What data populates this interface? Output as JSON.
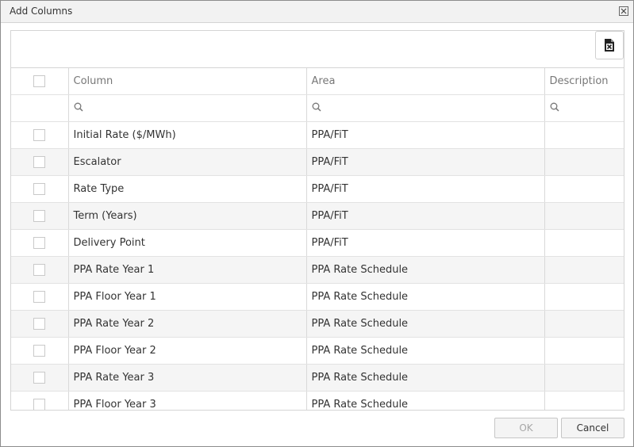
{
  "dialog": {
    "title": "Add Columns",
    "ok_label": "OK",
    "cancel_label": "Cancel",
    "ok_enabled": false
  },
  "toolbar": {
    "export_icon": "excel-export-icon"
  },
  "grid": {
    "headers": {
      "column": "Column",
      "area": "Area",
      "description": "Description"
    },
    "rows": [
      {
        "column": "Initial Rate ($/MWh)",
        "area": "PPA/FiT",
        "description": "",
        "checked": false
      },
      {
        "column": "Escalator",
        "area": "PPA/FiT",
        "description": "",
        "checked": false
      },
      {
        "column": "Rate Type",
        "area": "PPA/FiT",
        "description": "",
        "checked": false
      },
      {
        "column": "Term (Years)",
        "area": "PPA/FiT",
        "description": "",
        "checked": false
      },
      {
        "column": "Delivery Point",
        "area": "PPA/FiT",
        "description": "",
        "checked": false
      },
      {
        "column": "PPA Rate Year 1",
        "area": "PPA Rate Schedule",
        "description": "",
        "checked": false
      },
      {
        "column": "PPA Floor Year 1",
        "area": "PPA Rate Schedule",
        "description": "",
        "checked": false
      },
      {
        "column": "PPA Rate Year 2",
        "area": "PPA Rate Schedule",
        "description": "",
        "checked": false
      },
      {
        "column": "PPA Floor Year 2",
        "area": "PPA Rate Schedule",
        "description": "",
        "checked": false
      },
      {
        "column": "PPA Rate Year 3",
        "area": "PPA Rate Schedule",
        "description": "",
        "checked": false
      },
      {
        "column": "PPA Floor Year 3",
        "area": "PPA Rate Schedule",
        "description": "",
        "checked": false
      }
    ]
  },
  "colors": {
    "alt_row": "#f5f5f5",
    "border": "#d4d4d4",
    "header_text": "#777777"
  }
}
